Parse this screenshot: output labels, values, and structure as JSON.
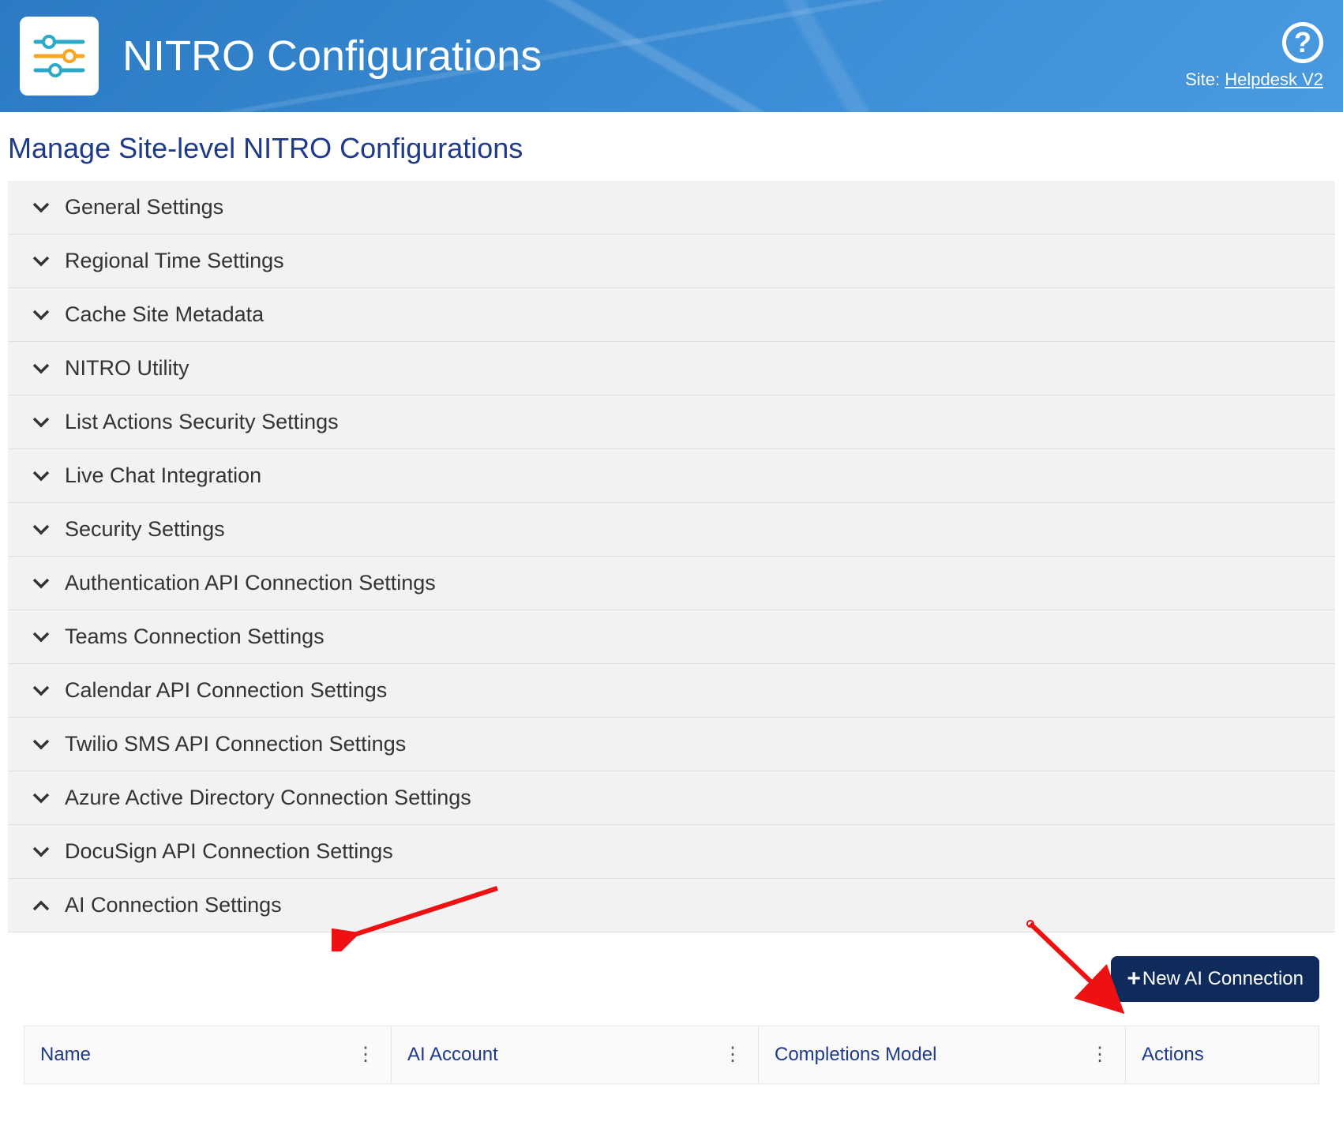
{
  "header": {
    "title": "NITRO Configurations",
    "site_label": "Site:",
    "site_name": "Helpdesk V2",
    "help_symbol": "?"
  },
  "subtitle": "Manage Site-level NITRO Configurations",
  "accordion": [
    {
      "label": "General Settings",
      "expanded": false
    },
    {
      "label": "Regional Time Settings",
      "expanded": false
    },
    {
      "label": "Cache Site Metadata",
      "expanded": false
    },
    {
      "label": "NITRO Utility",
      "expanded": false
    },
    {
      "label": "List Actions Security Settings",
      "expanded": false
    },
    {
      "label": "Live Chat Integration",
      "expanded": false
    },
    {
      "label": "Security Settings",
      "expanded": false
    },
    {
      "label": "Authentication API Connection Settings",
      "expanded": false
    },
    {
      "label": "Teams Connection Settings",
      "expanded": false
    },
    {
      "label": "Calendar API Connection Settings",
      "expanded": false
    },
    {
      "label": "Twilio SMS API Connection Settings",
      "expanded": false
    },
    {
      "label": "Azure Active Directory Connection Settings",
      "expanded": false
    },
    {
      "label": "DocuSign API Connection Settings",
      "expanded": false
    },
    {
      "label": "AI Connection Settings",
      "expanded": true
    }
  ],
  "ai_panel": {
    "new_button": "New AI Connection",
    "columns": [
      "Name",
      "AI Account",
      "Completions Model",
      "Actions"
    ]
  }
}
